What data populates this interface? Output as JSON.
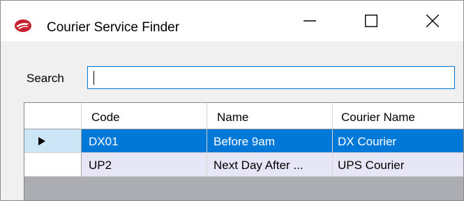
{
  "window": {
    "title": "Courier Service Finder",
    "icon": "courier-logo-icon",
    "controls": {
      "minimize": "minimize-icon",
      "maximize": "maximize-icon",
      "close": "close-icon"
    }
  },
  "search": {
    "label": "Search",
    "value": ""
  },
  "grid": {
    "columns": [
      "Code",
      "Name",
      "Courier Name"
    ],
    "rows": [
      {
        "code": "DX01",
        "name": "Before 9am",
        "courier": "DX Courier",
        "selected": true
      },
      {
        "code": "UP2",
        "name": "Next Day After ...",
        "courier": "UPS Courier",
        "selected": false
      }
    ]
  },
  "colors": {
    "selection": "#0078d7",
    "alt_row": "#e6e6f7",
    "row_header_selected": "#cde6f7",
    "accent": "#c8202f"
  }
}
